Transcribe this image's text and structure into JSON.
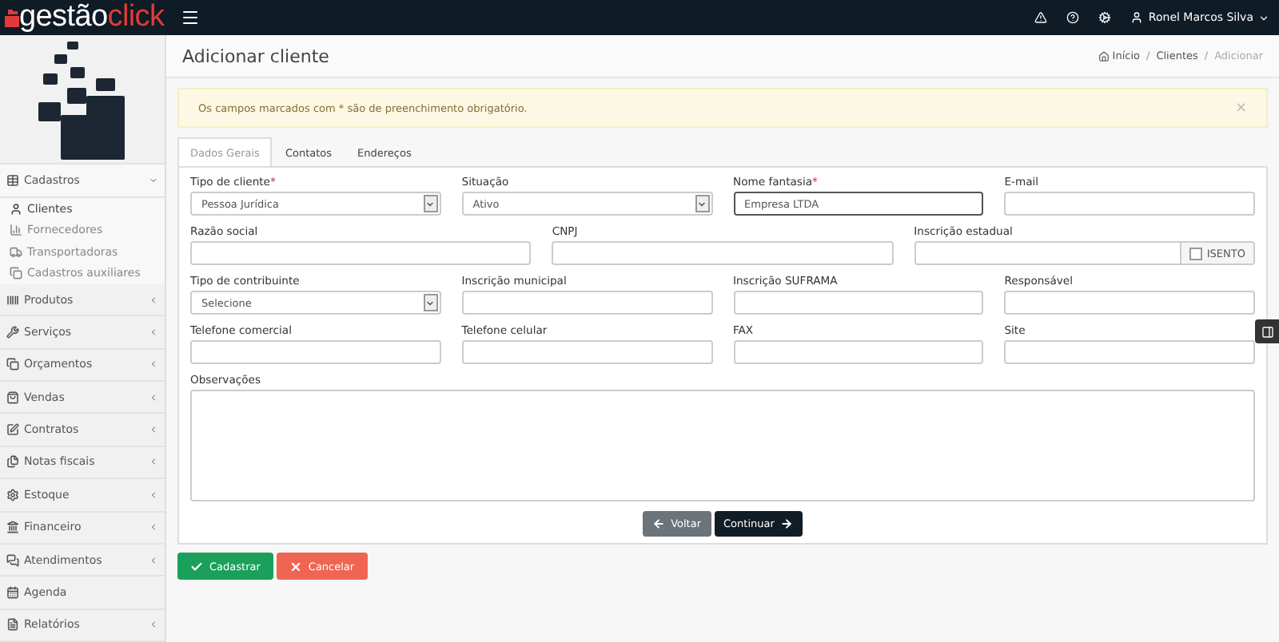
{
  "topbar": {
    "logo_first": "gestão",
    "logo_second": "click",
    "user": "Ronel Marcos Silva"
  },
  "sidebar": {
    "items": [
      {
        "label": "Cadastros",
        "kind": "table",
        "expanded": true,
        "children": [
          {
            "label": "Clientes",
            "kind": "user",
            "selected": true
          },
          {
            "label": "Fornecedores",
            "kind": "chart",
            "selected": false
          },
          {
            "label": "Transportadoras",
            "kind": "truck",
            "selected": false
          },
          {
            "label": "Cadastros auxiliares",
            "kind": "copy",
            "selected": false
          }
        ]
      },
      {
        "label": "Produtos",
        "kind": "barcode",
        "expanded": false
      },
      {
        "label": "Serviços",
        "kind": "wrench",
        "expanded": false
      },
      {
        "label": "Orçamentos",
        "kind": "copy",
        "expanded": false
      },
      {
        "label": "Vendas",
        "kind": "bag",
        "expanded": false
      },
      {
        "label": "Contratos",
        "kind": "edit",
        "expanded": false
      },
      {
        "label": "Notas fiscais",
        "kind": "files",
        "expanded": false
      },
      {
        "label": "Estoque",
        "kind": "gear",
        "expanded": false
      },
      {
        "label": "Financeiro",
        "kind": "bank",
        "expanded": false
      },
      {
        "label": "Atendimentos",
        "kind": "chat",
        "expanded": false
      },
      {
        "label": "Agenda",
        "kind": "calendar",
        "expanded": false,
        "leaf": true
      },
      {
        "label": "Relatórios",
        "kind": "report",
        "expanded": false
      }
    ]
  },
  "page": {
    "title": "Adicionar cliente",
    "breadcrumb": [
      {
        "label": "Início",
        "home": true
      },
      {
        "label": "Clientes",
        "separator": "/"
      },
      {
        "label": "Adicionar",
        "separator": "/"
      }
    ]
  },
  "alert": {
    "text": "Os campos marcados com * são de preenchimento obrigatório.",
    "close": "×"
  },
  "tabs": [
    {
      "label": "Dados Gerais",
      "selected": true
    },
    {
      "label": "Contatos",
      "selected": false
    },
    {
      "label": "Endereços",
      "selected": false
    }
  ],
  "form": {
    "fields": [
      {
        "label": "Tipo de cliente",
        "mark": "*",
        "kind": "select",
        "value": "Pessoa Jurídica"
      },
      {
        "label": "Situação",
        "kind": "select",
        "value": "Ativo"
      },
      {
        "label": "Nome fantasia",
        "mark": "*",
        "kind": "text",
        "value": "Empresa LTDA",
        "focused": true
      },
      {
        "label": "E-mail",
        "kind": "text"
      },
      {
        "label": "Razão social",
        "kind": "text"
      },
      {
        "label": "CNPJ",
        "kind": "text"
      },
      {
        "label": "Inscrição estadual",
        "kind": "addon",
        "addon": "ISENTO",
        "checked": false
      },
      {
        "label": "Tipo de contribuinte",
        "kind": "select",
        "value": "Selecione"
      },
      {
        "label": "Inscrição municipal",
        "kind": "text"
      },
      {
        "label": "Inscrição SUFRAMA",
        "kind": "text"
      },
      {
        "label": "Responsável",
        "kind": "text"
      },
      {
        "label": "Telefone comercial",
        "kind": "text"
      },
      {
        "label": "Telefone celular",
        "kind": "text"
      },
      {
        "label": "FAX",
        "kind": "text"
      },
      {
        "label": "Site",
        "kind": "text"
      }
    ],
    "notes_label": "Observações"
  },
  "nav_buttons": [
    {
      "label": "Voltar",
      "kind": "back"
    },
    {
      "label": "Continuar",
      "kind": "next"
    }
  ],
  "actions": [
    {
      "label": "Cadastrar",
      "kind": "save"
    },
    {
      "label": "Cancelar",
      "kind": "cancel"
    }
  ]
}
